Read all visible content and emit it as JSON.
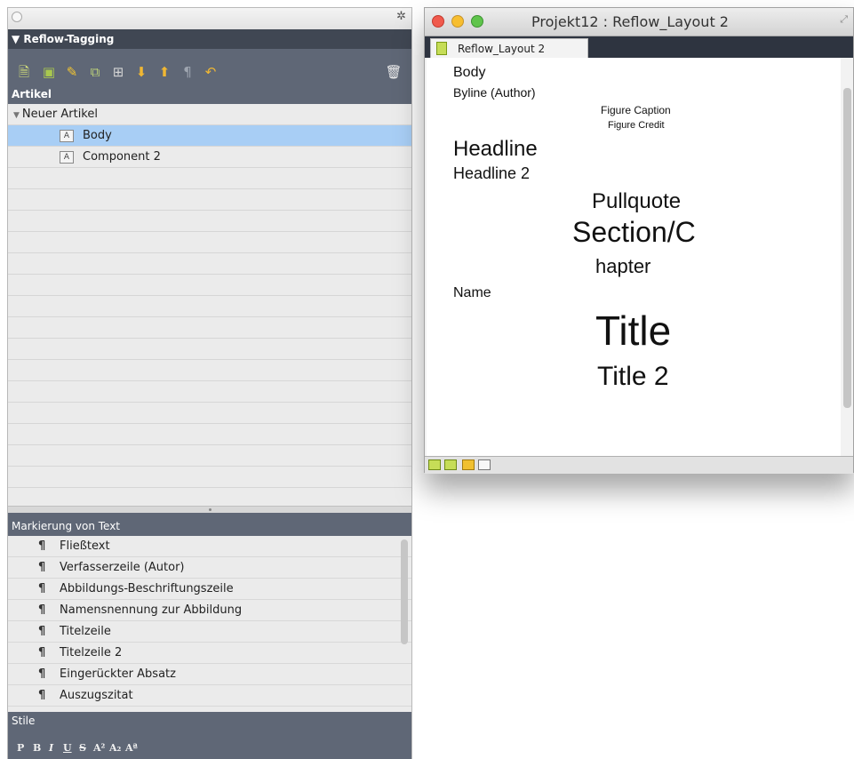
{
  "panel": {
    "reflow_header": "▼ Reflow-Tagging",
    "artikel_header": "Artikel",
    "tree": {
      "root": "Neuer Artikel",
      "items": [
        "Body",
        "Component 2"
      ]
    },
    "markierung_header": "Markierung von Text",
    "paragraph_styles": [
      "Fließtext",
      "Verfasserzeile (Autor)",
      "Abbildungs-Beschriftungszeile",
      "Namensnennung zur Abbildung",
      "Titelzeile",
      "Titelzeile 2",
      "Eingerückter Absatz",
      "Auszugszitat"
    ],
    "stile_header": "Stile",
    "stile_buttons": [
      "P",
      "B",
      "I",
      "U",
      "S",
      "A²",
      "A₂",
      "Aª"
    ]
  },
  "window": {
    "title": "Projekt12 : Reflow_Layout 2",
    "tab_label": "Reflow_Layout 2",
    "content": {
      "body": "Body",
      "byline": "Byline (Author)",
      "figure_caption": "Figure Caption",
      "figure_credit": "Figure Credit",
      "headline": "Headline",
      "headline2": "Headline 2",
      "pullquote": "Pullquote",
      "section1": "Section/C",
      "section2": "hapter",
      "name": "Name",
      "title": "Title",
      "title2": "Title 2"
    }
  },
  "colors": {
    "panel_header": "#5f6776",
    "selection": "#a8cef5",
    "tab_bar": "#2e3440"
  }
}
